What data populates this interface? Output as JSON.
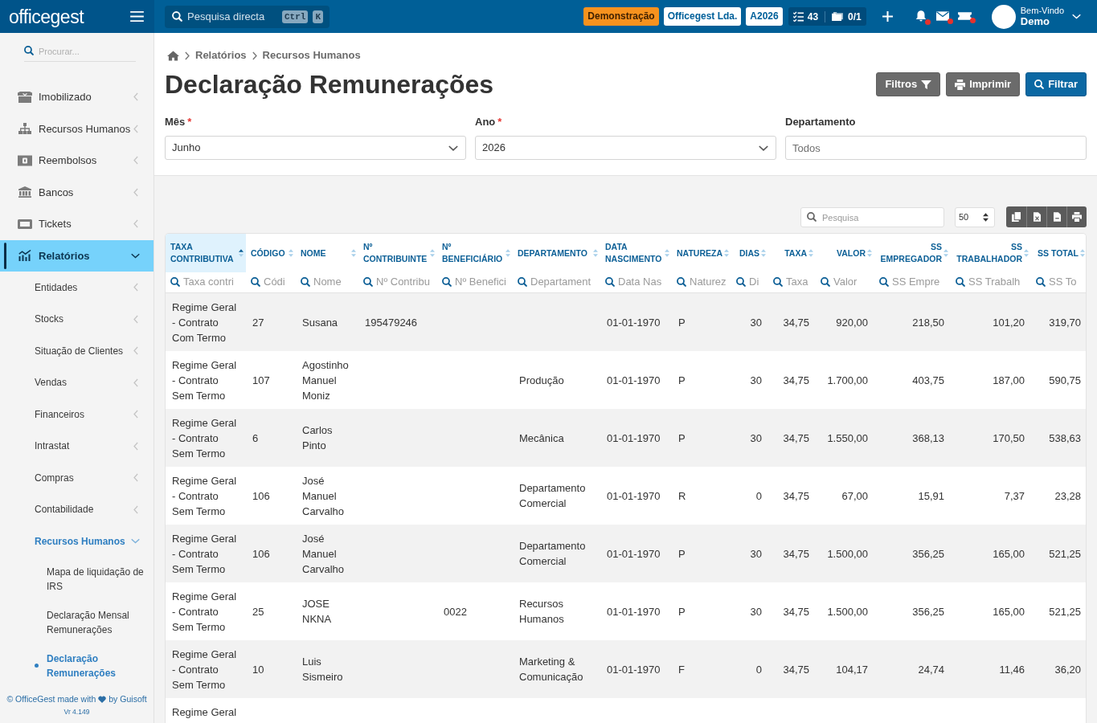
{
  "topbar": {
    "logo": "officegest",
    "search": {
      "placeholder": "Pesquisa directa",
      "shortcut_keys": [
        "Ctrl",
        "K"
      ]
    },
    "badges": [
      {
        "label": "Demonstração",
        "kind": "warning"
      },
      {
        "label": "Officegest Lda.",
        "kind": "light"
      },
      {
        "label": "A2026",
        "kind": "light"
      }
    ],
    "tasks_count": "43",
    "folders_count": "0/1",
    "notifications": [
      {
        "unread": true
      },
      {
        "unread": true
      },
      {
        "unread": true
      }
    ],
    "user": {
      "greeting": "Bem-Vindo",
      "name": "Demo"
    }
  },
  "sidebar": {
    "search_placeholder": "Procurar...",
    "items": [
      {
        "label": "Imobilizado",
        "selected": false,
        "expanded": false
      },
      {
        "label": "Recursos Humanos",
        "selected": false,
        "expanded": false
      },
      {
        "label": "Reembolsos",
        "selected": false,
        "expanded": false
      },
      {
        "label": "Bancos",
        "selected": false,
        "expanded": false
      },
      {
        "label": "Tickets",
        "selected": false,
        "expanded": false
      },
      {
        "label": "Relatórios",
        "selected": true,
        "expanded": true,
        "children": [
          {
            "label": "Entidades",
            "selected": false,
            "expanded": false
          },
          {
            "label": "Stocks",
            "selected": false,
            "expanded": false
          },
          {
            "label": "Situação de Clientes",
            "selected": false,
            "expanded": false
          },
          {
            "label": "Vendas",
            "selected": false,
            "expanded": false
          },
          {
            "label": "Financeiros",
            "selected": false,
            "expanded": false
          },
          {
            "label": "Intrastat",
            "selected": false,
            "expanded": false
          },
          {
            "label": "Compras",
            "selected": false,
            "expanded": false
          },
          {
            "label": "Contabilidade",
            "selected": false,
            "expanded": false
          },
          {
            "label": "Recursos Humanos",
            "selected": true,
            "expanded": true,
            "children": [
              {
                "label": "Mapa de liquidação de IRS",
                "selected": false
              },
              {
                "label": "Declaração Mensal Remunerações",
                "selected": false
              },
              {
                "label": "Declaração Remunerações",
                "selected": true
              }
            ]
          }
        ]
      }
    ],
    "footer": {
      "text_before": "© OfficeGest made with",
      "text_after": "by Guisoft",
      "version": "Vr 4.149"
    }
  },
  "breadcrumb": [
    "Relatórios",
    "Recursos Humanos"
  ],
  "title": "Declaração Remunerações",
  "actions": [
    {
      "label": "Filtros",
      "kind": "secondary"
    },
    {
      "label": "Imprimir",
      "kind": "secondary"
    },
    {
      "label": "Filtrar",
      "kind": "primary"
    }
  ],
  "form": {
    "required_mark": "*",
    "fields": [
      {
        "label": "Mês",
        "required": true,
        "kind": "select",
        "value": "Junho"
      },
      {
        "label": "Ano",
        "required": true,
        "kind": "select",
        "value": "2026"
      },
      {
        "label": "Departamento",
        "required": false,
        "kind": "input",
        "placeholder": "Todos"
      }
    ]
  },
  "table_toolbar": {
    "search_placeholder": "Pesquisa",
    "page_size": "50"
  },
  "table": {
    "columns": [
      {
        "label": "TAXA CONTRIBUTIVA",
        "kind": "text",
        "sorted": true,
        "filter_placeholder": "Taxa contri"
      },
      {
        "label": "CÓDIGO",
        "kind": "text",
        "sorted": false,
        "filter_placeholder": "Códi"
      },
      {
        "label": "NOME",
        "kind": "text",
        "sorted": false,
        "filter_placeholder": "Nome"
      },
      {
        "label": "Nº CONTRIBUINTE",
        "kind": "text",
        "sorted": false,
        "filter_placeholder": "Nº Contribu"
      },
      {
        "label": "Nº BENEFICIÁRIO",
        "kind": "text",
        "sorted": false,
        "filter_placeholder": "Nº Benefici"
      },
      {
        "label": "DEPARTAMENTO",
        "kind": "text",
        "sorted": false,
        "filter_placeholder": "Departament"
      },
      {
        "label": "DATA NASCIMENTO",
        "kind": "text",
        "sorted": false,
        "filter_placeholder": "Data Nas"
      },
      {
        "label": "NATUREZA",
        "kind": "text",
        "sorted": false,
        "filter_placeholder": "Naturez"
      },
      {
        "label": "DIAS",
        "kind": "number",
        "sorted": false,
        "filter_placeholder": "Di"
      },
      {
        "label": "TAXA",
        "kind": "number",
        "sorted": false,
        "filter_placeholder": "Taxa"
      },
      {
        "label": "VALOR",
        "kind": "number",
        "sorted": false,
        "filter_placeholder": "Valor"
      },
      {
        "label": "SS EMPREGADOR",
        "kind": "number",
        "sorted": false,
        "filter_placeholder": "SS Empre"
      },
      {
        "label": "SS TRABALHADOR",
        "kind": "number",
        "sorted": false,
        "filter_placeholder": "SS Trabalh"
      },
      {
        "label": "SS TOTAL",
        "kind": "number",
        "sorted": false,
        "filter_placeholder": "SS To"
      }
    ],
    "rows": [
      {
        "contribution_rate": "Regime Geral - Contrato Com Termo",
        "code": "27",
        "name": "Susana",
        "taxpayer_number": "195479246",
        "birth_date": "01-01-1970",
        "nature": "P",
        "days": "30",
        "rate": "34,75",
        "value": "920,00",
        "ss_employer": "218,50",
        "ss_worker": "101,20",
        "ss_total": "319,70"
      },
      {
        "contribution_rate": "Regime Geral - Contrato Sem Termo",
        "code": "107",
        "name": "Agostinho Manuel Moniz",
        "department": "Produção",
        "birth_date": "01-01-1970",
        "nature": "P",
        "days": "30",
        "rate": "34,75",
        "value": "1.700,00",
        "ss_employer": "403,75",
        "ss_worker": "187,00",
        "ss_total": "590,75"
      },
      {
        "contribution_rate": "Regime Geral - Contrato Sem Termo",
        "code": "6",
        "name": "Carlos Pinto",
        "department": "Mecânica",
        "birth_date": "01-01-1970",
        "nature": "P",
        "days": "30",
        "rate": "34,75",
        "value": "1.550,00",
        "ss_employer": "368,13",
        "ss_worker": "170,50",
        "ss_total": "538,63"
      },
      {
        "contribution_rate": "Regime Geral - Contrato Sem Termo",
        "code": "106",
        "name": "José Manuel Carvalho",
        "department": "Departamento Comercial",
        "birth_date": "01-01-1970",
        "nature": "R",
        "days": "0",
        "rate": "34,75",
        "value": "67,00",
        "ss_employer": "15,91",
        "ss_worker": "7,37",
        "ss_total": "23,28"
      },
      {
        "contribution_rate": "Regime Geral - Contrato Sem Termo",
        "code": "106",
        "name": "José Manuel Carvalho",
        "department": "Departamento Comercial",
        "birth_date": "01-01-1970",
        "nature": "P",
        "days": "30",
        "rate": "34,75",
        "value": "1.500,00",
        "ss_employer": "356,25",
        "ss_worker": "165,00",
        "ss_total": "521,25"
      },
      {
        "contribution_rate": "Regime Geral - Contrato Sem Termo",
        "code": "25",
        "name": "JOSE NKNA",
        "beneficiary_number": "0022",
        "department": "Recursos Humanos",
        "birth_date": "01-01-1970",
        "nature": "P",
        "days": "30",
        "rate": "34,75",
        "value": "1.500,00",
        "ss_employer": "356,25",
        "ss_worker": "165,00",
        "ss_total": "521,25"
      },
      {
        "contribution_rate": "Regime Geral - Contrato Sem Termo",
        "code": "10",
        "name": "Luis Sismeiro",
        "department": "Marketing & Comunicação",
        "birth_date": "01-01-1970",
        "nature": "F",
        "days": "0",
        "rate": "34,75",
        "value": "104,17",
        "ss_employer": "24,74",
        "ss_worker": "11,46",
        "ss_total": "36,20"
      },
      {
        "contribution_rate": "Regime Geral"
      }
    ]
  }
}
